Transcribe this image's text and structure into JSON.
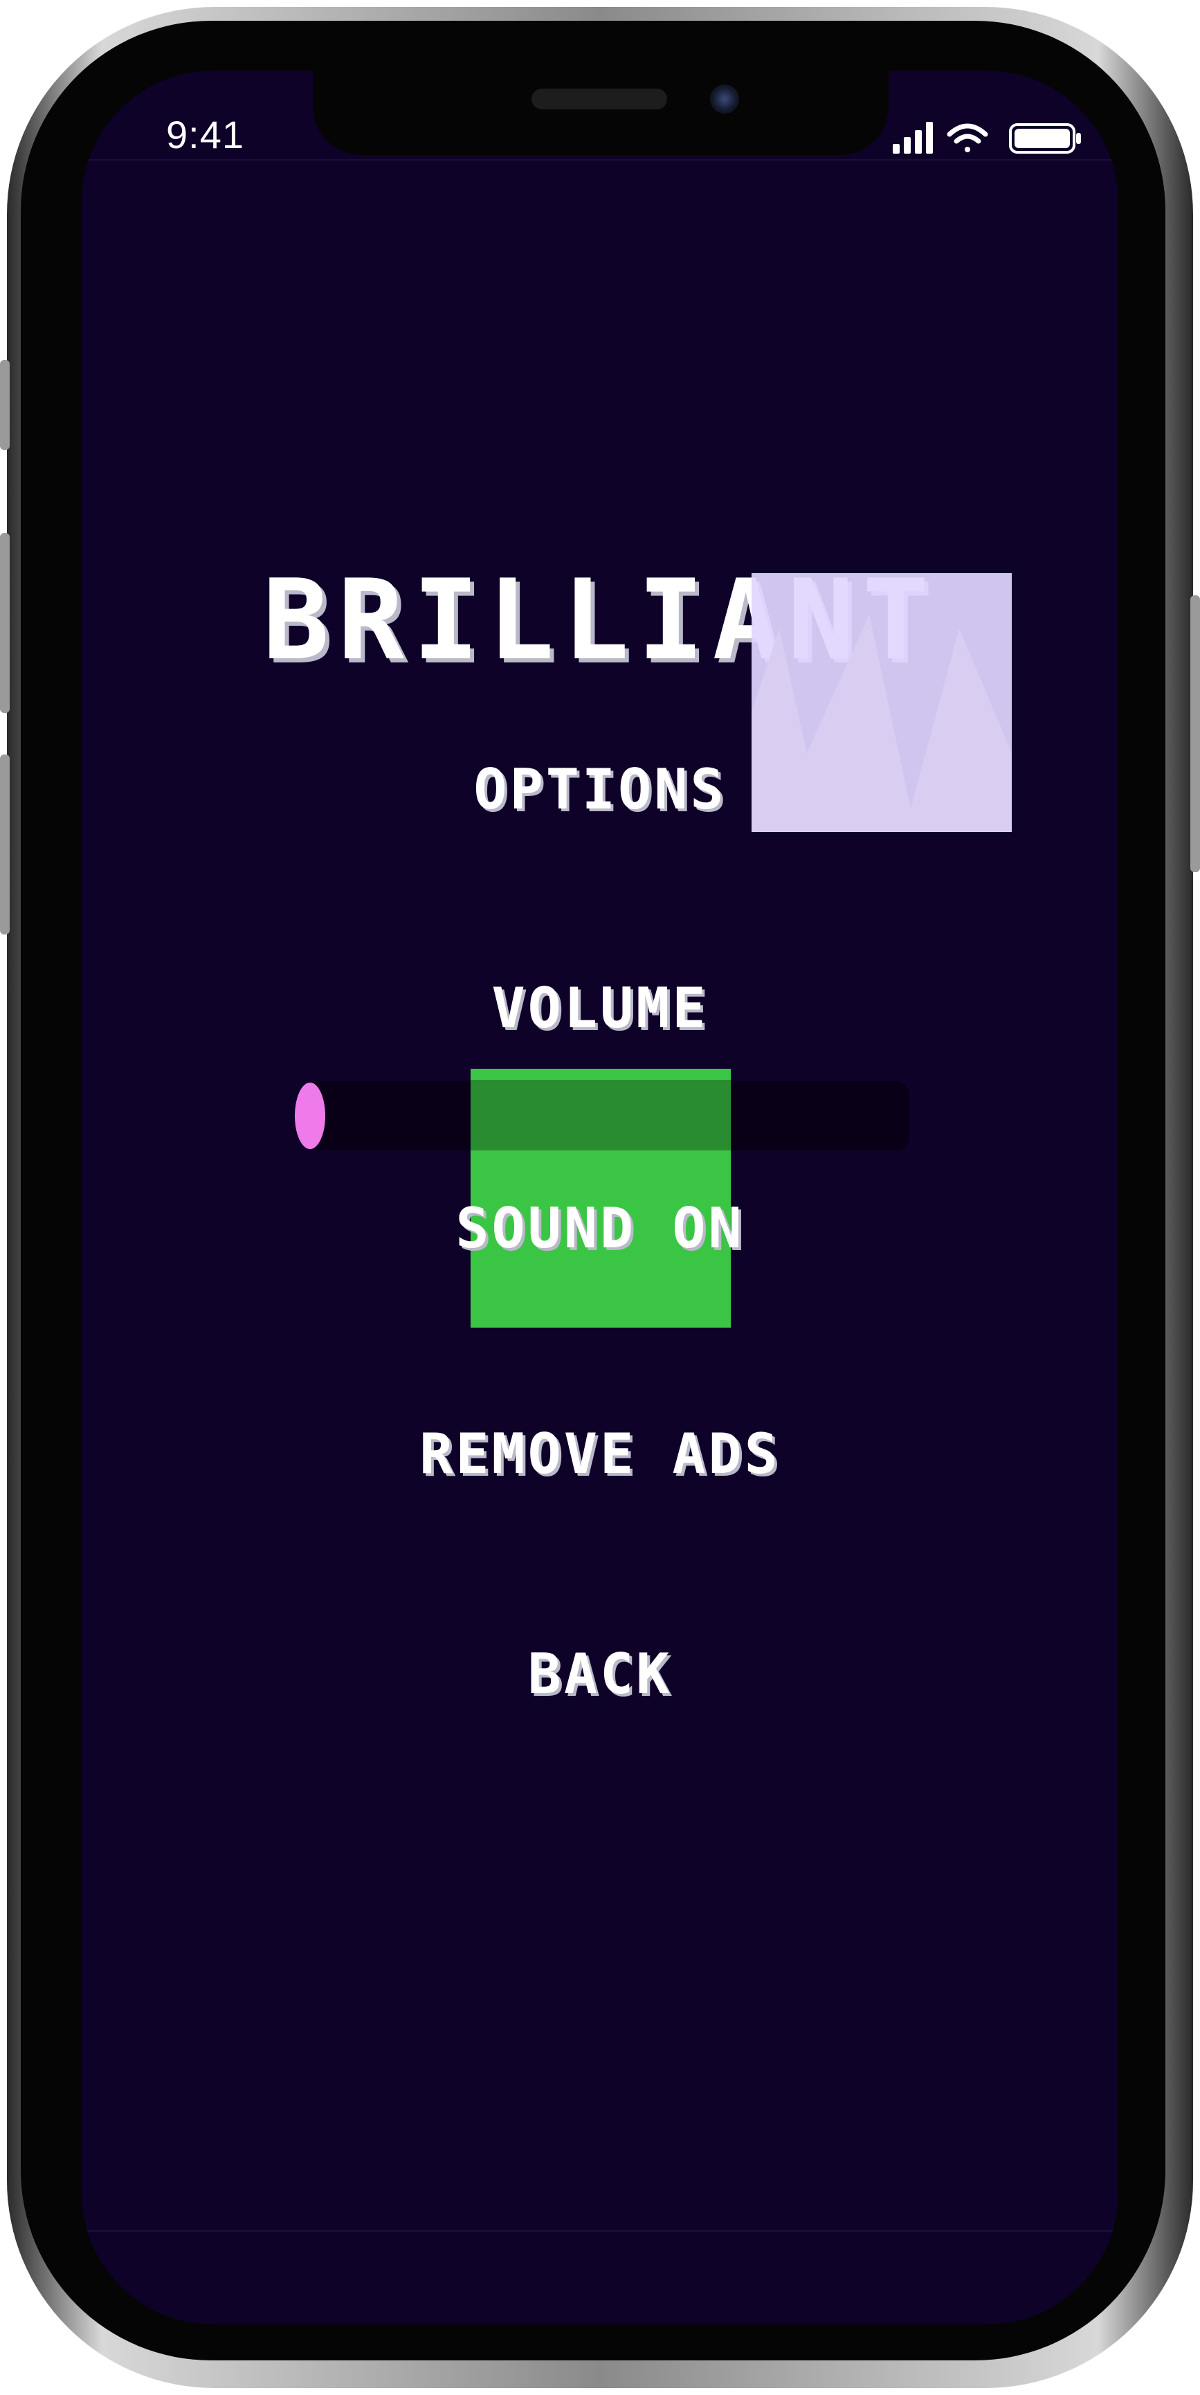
{
  "status_bar": {
    "time": "9:41",
    "icons": [
      "cellular-signal-icon",
      "wifi-icon",
      "battery-icon"
    ]
  },
  "game": {
    "title": "BRILLIANT",
    "subtitle": "OPTIONS",
    "menu": {
      "volume_label": "VOLUME",
      "sound_label": "SOUND ON",
      "remove_ads_label": "REMOVE ADS",
      "back_label": "BACK"
    },
    "volume_level": 0.0
  },
  "colors": {
    "background": "#0e0229",
    "text": "#ffffff",
    "volume_knob": "#ef7bea",
    "sound_toggle": "#3bc545",
    "overlay": "#e1d6ff"
  }
}
